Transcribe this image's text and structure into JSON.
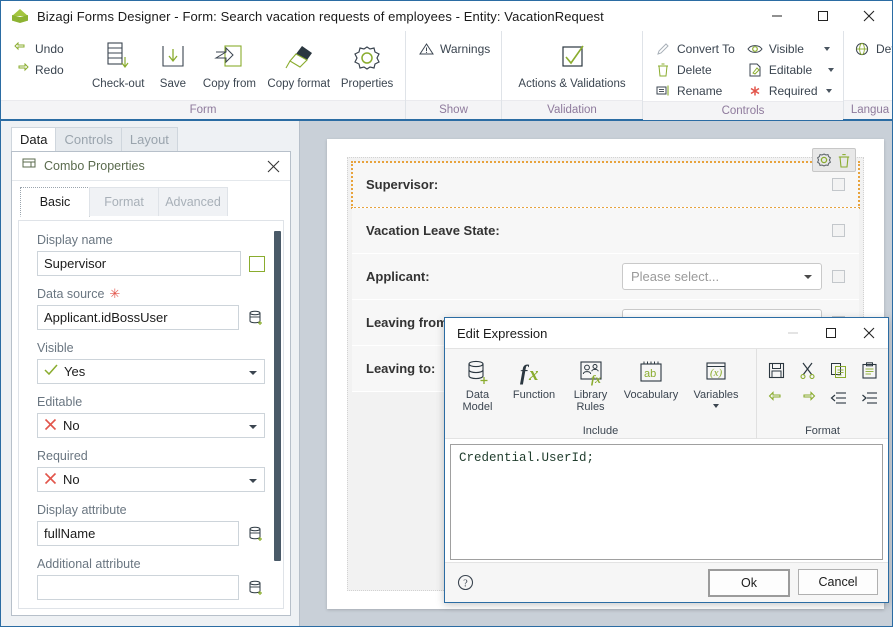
{
  "window": {
    "title": "Bizagi Forms Designer  - Form: Search vacation requests of employees - Entity:  VacationRequest",
    "logo_icon": "bizagi-cube-icon",
    "minimize_label": "Minimize",
    "maximize_label": "Maximize",
    "close_label": "Close"
  },
  "ribbon": {
    "groups": [
      {
        "label": "Form",
        "small_buttons": [
          {
            "label": "Undo",
            "icon": "undo-icon"
          },
          {
            "label": "Redo",
            "icon": "redo-icon"
          }
        ],
        "big_buttons": [
          {
            "label": "Check-out",
            "icon": "check-out-icon"
          },
          {
            "label": "Save",
            "icon": "save-icon"
          },
          {
            "label": "Copy from",
            "icon": "copy-from-icon"
          },
          {
            "label": "Copy format",
            "icon": "copy-format-icon"
          },
          {
            "label": "Properties",
            "icon": "properties-gear-icon"
          }
        ]
      },
      {
        "label": "Show",
        "small_buttons": [
          {
            "label": "Warnings",
            "icon": "warning-triangle-icon"
          }
        ],
        "big_buttons": []
      },
      {
        "label": "Validation",
        "small_buttons": [],
        "big_buttons": [
          {
            "label": "Actions & Validations",
            "icon": "checkbox-check-icon"
          }
        ]
      },
      {
        "label": "Controls",
        "small_buttons": [
          {
            "label": "Convert To",
            "icon": "convert-to-icon"
          },
          {
            "label": "Delete",
            "icon": "trash-icon"
          },
          {
            "label": "Rename",
            "icon": "rename-icon"
          }
        ],
        "small_buttons_2": [
          {
            "label": "Visible",
            "icon": "eye-icon",
            "has_caret": true
          },
          {
            "label": "Editable",
            "icon": "pencil-page-icon",
            "has_caret": true
          },
          {
            "label": "Required",
            "icon": "asterisk-icon",
            "has_caret": true
          }
        ],
        "big_buttons": []
      },
      {
        "label": "Langua",
        "small_buttons": [
          {
            "label": "Defa",
            "icon": "globe-icon"
          }
        ],
        "big_buttons": []
      }
    ]
  },
  "left_panel": {
    "tabs": [
      {
        "label": "Data",
        "active": true
      },
      {
        "label": "Controls",
        "active": false
      },
      {
        "label": "Layout",
        "active": false
      }
    ],
    "properties": {
      "header_icon": "combo-icon",
      "header_title": "Combo Properties",
      "close_label": "Close",
      "tabs": [
        {
          "label": "Basic",
          "active": true
        },
        {
          "label": "Format",
          "active": false
        },
        {
          "label": "Advanced",
          "active": false
        }
      ],
      "fields": [
        {
          "label": "Display name",
          "required": false,
          "type": "text",
          "value": "Supervisor",
          "placeholder": "",
          "trailing_icon": "color-swatch-icon"
        },
        {
          "label": "Data source",
          "required": true,
          "type": "text",
          "value": "Applicant.idBossUser",
          "placeholder": "",
          "trailing_icon": "database-add-icon"
        },
        {
          "label": "Visible",
          "required": false,
          "type": "select",
          "value": "Yes",
          "state_icon": "check-yes-icon"
        },
        {
          "label": "Editable",
          "required": false,
          "type": "select",
          "value": "No",
          "state_icon": "cross-no-icon"
        },
        {
          "label": "Required",
          "required": false,
          "type": "select",
          "value": "No",
          "state_icon": "cross-no-icon"
        },
        {
          "label": "Display attribute",
          "required": false,
          "type": "text",
          "value": "fullName",
          "placeholder": "",
          "trailing_icon": "database-add-icon"
        },
        {
          "label": "Additional attribute",
          "required": false,
          "type": "text",
          "value": "",
          "placeholder": "",
          "trailing_icon": "database-add-icon"
        }
      ]
    }
  },
  "canvas": {
    "rows": [
      {
        "label": "Supervisor:",
        "selected": true,
        "control": "none",
        "checkbox": true
      },
      {
        "label": "Vacation Leave State:",
        "selected": false,
        "control": "none",
        "checkbox": true
      },
      {
        "label": "Applicant:",
        "selected": false,
        "control": "dropdown",
        "dropdown_text": "Please select...",
        "checkbox": true
      },
      {
        "label": "Leaving from:",
        "selected": false,
        "control": "dropdown",
        "dropdown_text": "",
        "checkbox": true
      },
      {
        "label": "Leaving to:",
        "selected": false,
        "control": "none",
        "checkbox": false
      }
    ],
    "selection_tools": [
      {
        "icon": "gear-icon",
        "label": "Configure"
      },
      {
        "icon": "trash-icon",
        "label": "Delete"
      }
    ]
  },
  "dialog": {
    "title": "Edit Expression",
    "minimize_label": "Minimize",
    "maximize_label": "Maximize",
    "close_label": "Close",
    "ribbon": {
      "include_group_label": "Include",
      "include_buttons": [
        {
          "label": "Data Model",
          "icon": "data-model-icon",
          "has_caret": false
        },
        {
          "label": "Function",
          "icon": "function-fx-icon",
          "has_caret": false
        },
        {
          "label": "Library Rules",
          "icon": "library-rules-icon",
          "has_caret": false
        },
        {
          "label": "Vocabulary",
          "icon": "vocabulary-ab-icon",
          "has_caret": false
        },
        {
          "label": "Variables",
          "icon": "variables-x-icon",
          "has_caret": true
        }
      ],
      "format_group_label": "Format",
      "format_buttons": [
        {
          "icon": "save-disk-icon",
          "label": "Save"
        },
        {
          "icon": "cut-scissors-icon",
          "label": "Cut"
        },
        {
          "icon": "copy-icon",
          "label": "Copy"
        },
        {
          "icon": "paste-icon",
          "label": "Paste"
        },
        {
          "icon": "undo-icon",
          "label": "Undo"
        },
        {
          "icon": "redo-icon",
          "label": "Redo"
        },
        {
          "icon": "outdent-icon",
          "label": "Outdent"
        },
        {
          "icon": "indent-icon",
          "label": "Indent"
        }
      ]
    },
    "code": "Credential.UserId;",
    "help_icon": "help-question-icon",
    "ok_label": "Ok",
    "cancel_label": "Cancel"
  },
  "colors": {
    "accent_blue": "#2b6ca3",
    "brand_green": "#8db332",
    "group_label": "#8e7a9c",
    "selection_orange": "#e8a33d",
    "required_red": "#e2554b"
  }
}
